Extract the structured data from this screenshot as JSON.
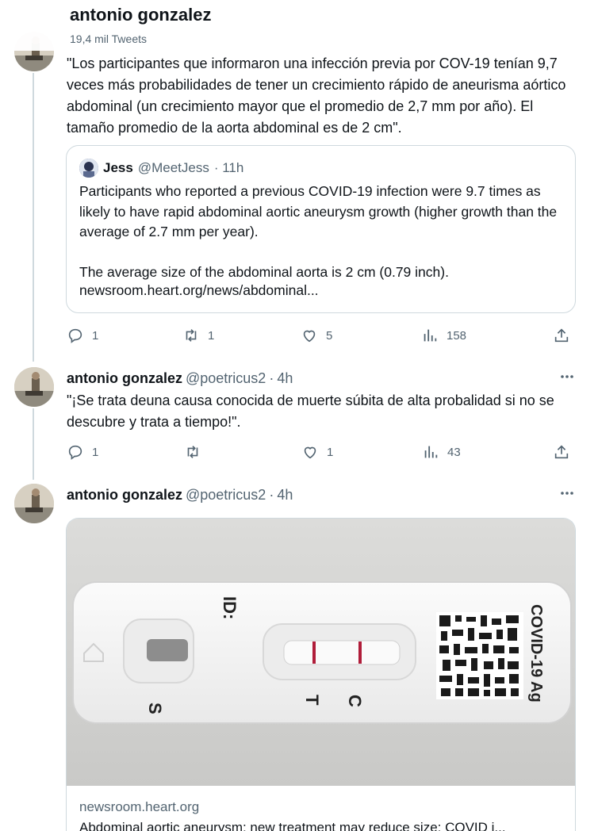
{
  "header": {
    "title": "antonio gonzalez",
    "subtitle": "19,4 mil Tweets"
  },
  "tweets": [
    {
      "text": "\"Los participantes que informaron una infección previa por COV-19 tenían 9,7 veces más probabilidades de tener un crecimiento rápido de aneurisma aórtico abdominal (un crecimiento mayor que el promedio de 2,7 mm por año). El tamaño promedio de la aorta abdominal es de 2 cm\".",
      "quote": {
        "name": "Jess",
        "handle": "@MeetJess",
        "time": "· 11h",
        "body": "Participants who reported a previous COVID-19 infection were 9.7 times as likely to have rapid abdominal aortic aneurysm growth (higher growth than the average of 2.7 mm per year).\n\nThe average size of the abdominal aorta is 2 cm (0.79 inch).",
        "link": "newsroom.heart.org/news/abdominal..."
      },
      "actions": {
        "replies": "1",
        "retweets": "1",
        "likes": "5",
        "views": "158"
      }
    },
    {
      "name": "antonio gonzalez",
      "handle": "@poetricus2",
      "time": "4h",
      "text": "\"¡Se trata deuna causa conocida de muerte súbita de alta probalidad si no se descubre y trata a tiempo!\".",
      "actions": {
        "replies": "1",
        "retweets": "",
        "likes": "1",
        "views": "43"
      }
    },
    {
      "name": "antonio gonzalez",
      "handle": "@poetricus2",
      "time": "4h",
      "card": {
        "image_labels": {
          "id": "ID:",
          "s": "S",
          "t": "T",
          "c": "C",
          "brand": "COVID-19 Ag"
        },
        "domain": "newsroom.heart.org",
        "title": "Abdominal aortic aneurysm: new treatment may reduce size; COVID i..."
      }
    }
  ],
  "icons": {
    "reply": "reply-icon",
    "retweet": "retweet-icon",
    "like": "heart-icon",
    "views": "views-icon",
    "share": "share-icon",
    "more": "more-icon"
  },
  "colors": {
    "text": "#0f1419",
    "secondary": "#536471",
    "border": "#cfd9de",
    "test_line": "#b01d3a"
  }
}
